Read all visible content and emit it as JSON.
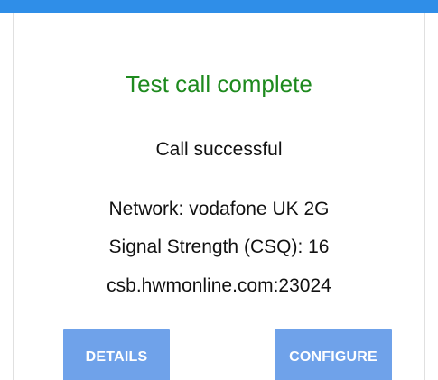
{
  "colors": {
    "top_bar": "#2f8ee8",
    "title": "#1e8a1e",
    "button_bg": "#6fa2ea",
    "button_text": "#ffffff"
  },
  "dialog": {
    "title": "Test call complete",
    "status": "Call successful",
    "network": "Network: vodafone UK  2G",
    "signal_strength": "Signal Strength (CSQ): 16",
    "server": "csb.hwmonline.com:23024"
  },
  "buttons": {
    "details_label": "DETAILS",
    "configure_label": "CONFIGURE"
  }
}
